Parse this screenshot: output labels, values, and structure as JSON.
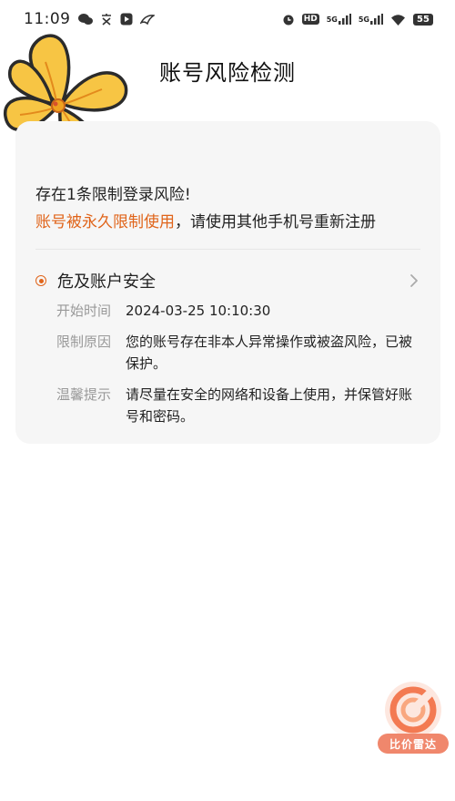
{
  "status_bar": {
    "time": "11:09",
    "icons": [
      "wechat-icon",
      "text-icon",
      "play-icon",
      "bird-icon",
      "alarm-icon",
      "hd-icon",
      "signal-5g-icon",
      "signal-5g-icon",
      "wifi-icon",
      "battery-icon"
    ],
    "hd_label": "HD",
    "net1_label": "5G",
    "net2_label": "5G",
    "battery": "55"
  },
  "header": {
    "title": "账号风险检测"
  },
  "summary": {
    "line1": "存在1条限制登录风险!",
    "warning": "账号被永久限制使用",
    "rest": "，请使用其他手机号重新注册"
  },
  "risk": {
    "title": "危及账户安全",
    "details": [
      {
        "label": "开始时间",
        "value": "2024-03-25 10:10:30"
      },
      {
        "label": "限制原因",
        "value": "您的账号存在非本人异常操作或被盗风险，已被保护。"
      },
      {
        "label": "温馨提示",
        "value": "请尽量在安全的网络和设备上使用，并保管好账号和密码。"
      }
    ]
  },
  "watermark": {
    "label": "比价雷达"
  },
  "colors": {
    "accent": "#e0641a",
    "card_bg": "#f6f6f6",
    "label": "#999999"
  }
}
